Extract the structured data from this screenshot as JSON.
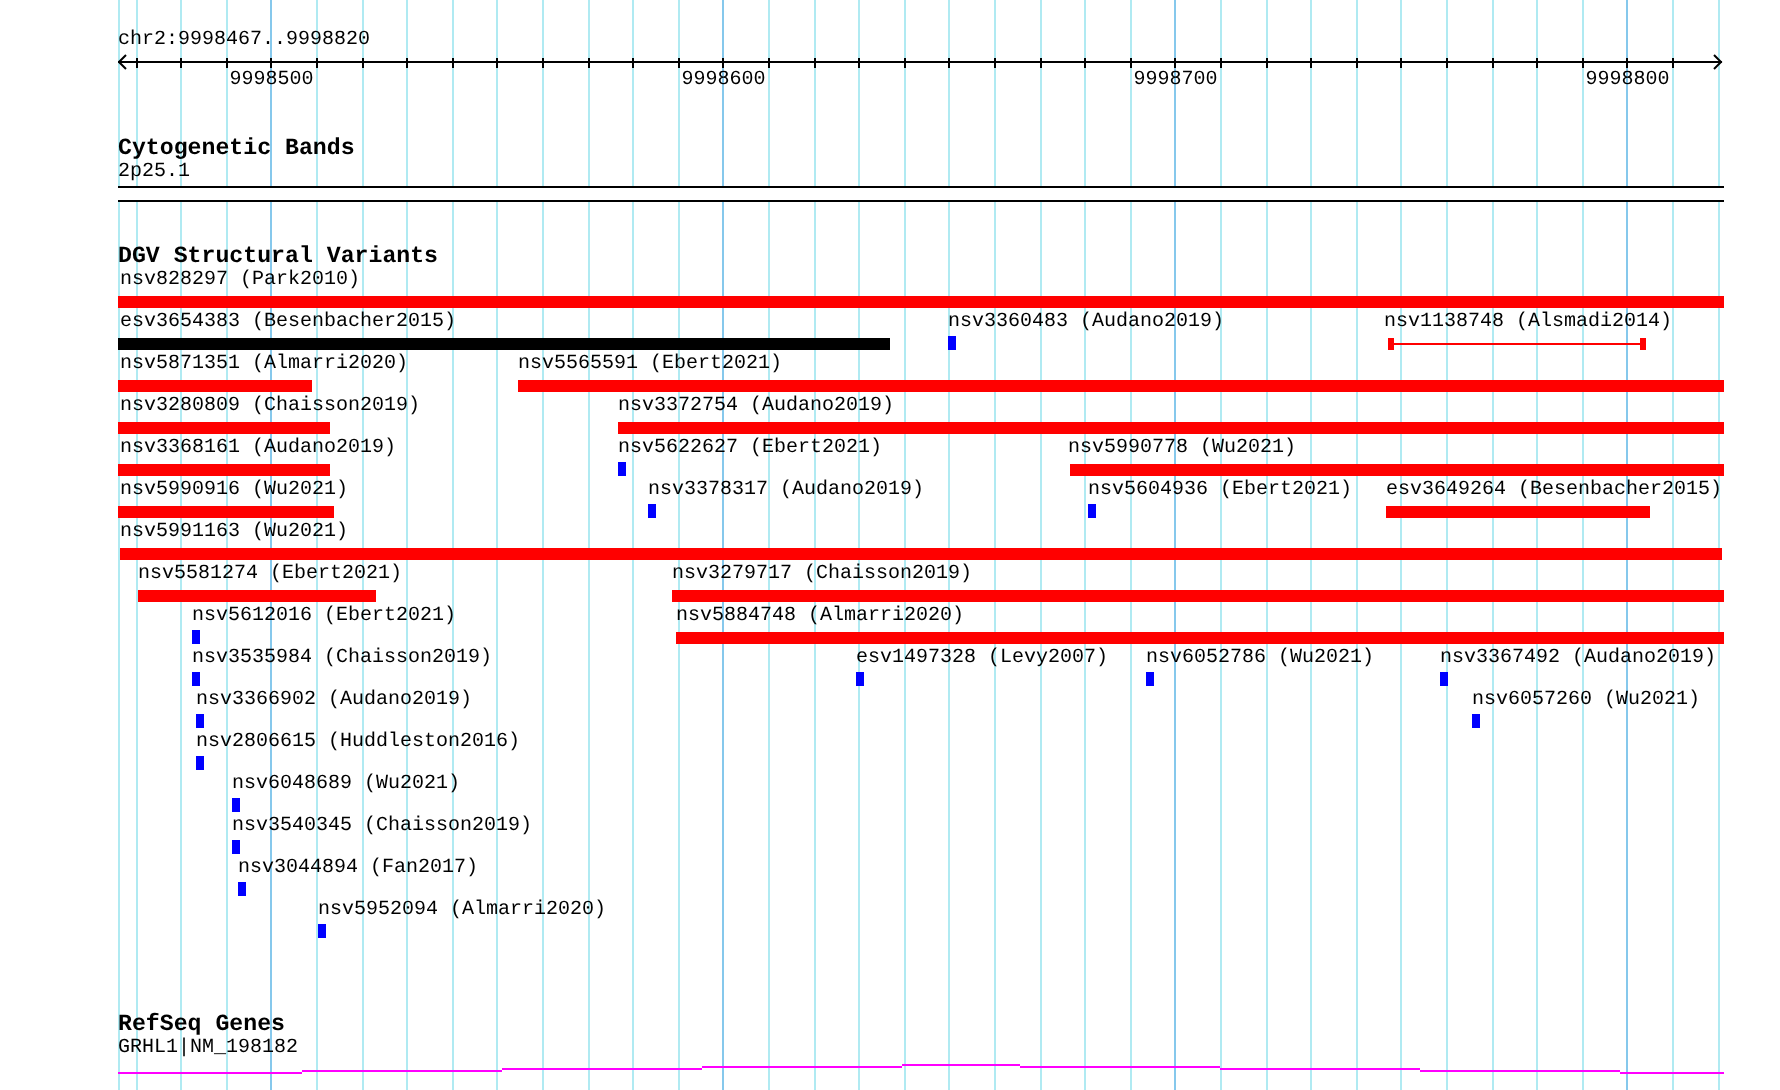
{
  "ruler": {
    "location": "chr2:9998467..9998820",
    "tick_labels": [
      "9998500",
      "9998600",
      "9998700",
      "9998800"
    ]
  },
  "cytogenetic_track": {
    "title": "Cytogenetic Bands",
    "band": "2p25.1"
  },
  "dgv_track": {
    "title": "DGV Structural Variants",
    "features": [
      {
        "label": "nsv828297 (Park2010)",
        "kind": "bar"
      },
      {
        "label": "esv3654383 (Besenbacher2015)",
        "kind": "dark_bar"
      },
      {
        "label": "nsv3360483 (Audano2019)",
        "kind": "point"
      },
      {
        "label": "nsv1138748 (Alsmadi2014)",
        "kind": "interval"
      },
      {
        "label": "nsv5871351 (Almarri2020)",
        "kind": "bar"
      },
      {
        "label": "nsv5565591 (Ebert2021)",
        "kind": "bar"
      },
      {
        "label": "nsv3280809 (Chaisson2019)",
        "kind": "bar"
      },
      {
        "label": "nsv3372754 (Audano2019)",
        "kind": "bar"
      },
      {
        "label": "nsv3368161 (Audano2019)",
        "kind": "bar"
      },
      {
        "label": "nsv5622627 (Ebert2021)",
        "kind": "point"
      },
      {
        "label": "nsv5990778 (Wu2021)",
        "kind": "bar"
      },
      {
        "label": "nsv5990916 (Wu2021)",
        "kind": "bar"
      },
      {
        "label": "nsv3378317 (Audano2019)",
        "kind": "point"
      },
      {
        "label": "nsv5604936 (Ebert2021)",
        "kind": "point"
      },
      {
        "label": "esv3649264 (Besenbacher2015)",
        "kind": "bar"
      },
      {
        "label": "nsv5991163 (Wu2021)",
        "kind": "bar"
      },
      {
        "label": "nsv5581274 (Ebert2021)",
        "kind": "bar"
      },
      {
        "label": "nsv3279717 (Chaisson2019)",
        "kind": "bar"
      },
      {
        "label": "nsv5612016 (Ebert2021)",
        "kind": "point"
      },
      {
        "label": "nsv5884748 (Almarri2020)",
        "kind": "bar"
      },
      {
        "label": "nsv3535984 (Chaisson2019)",
        "kind": "point"
      },
      {
        "label": "esv1497328 (Levy2007)",
        "kind": "point"
      },
      {
        "label": "nsv6052786 (Wu2021)",
        "kind": "point"
      },
      {
        "label": "nsv3367492 (Audano2019)",
        "kind": "point"
      },
      {
        "label": "nsv3366902 (Audano2019)",
        "kind": "point"
      },
      {
        "label": "nsv6057260 (Wu2021)",
        "kind": "point"
      },
      {
        "label": "nsv2806615 (Huddleston2016)",
        "kind": "point"
      },
      {
        "label": "nsv6048689 (Wu2021)",
        "kind": "point"
      },
      {
        "label": "nsv3540345 (Chaisson2019)",
        "kind": "point"
      },
      {
        "label": "nsv3044894 (Fan2017)",
        "kind": "point"
      },
      {
        "label": "nsv5952094 (Almarri2020)",
        "kind": "point"
      }
    ]
  },
  "refseq_track": {
    "title": "RefSeq Genes",
    "gene": "GRHL1|NM_198182"
  }
}
